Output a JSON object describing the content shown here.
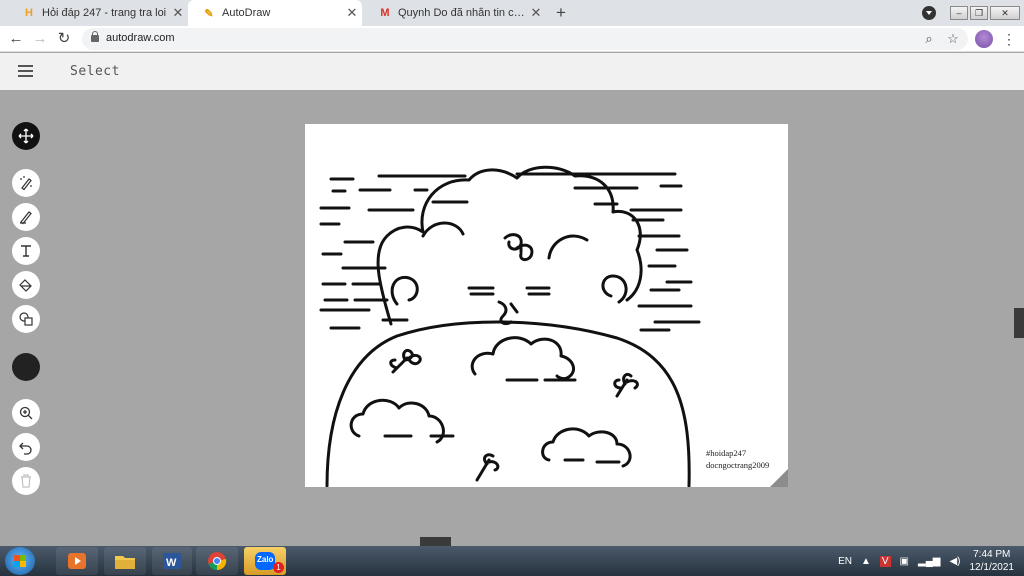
{
  "browser": {
    "tabs": [
      {
        "title": "Hỏi đáp 247 - trang tra loi",
        "favicon": "hoidap-favicon-icon",
        "active": false
      },
      {
        "title": "AutoDraw",
        "favicon": "autodraw-favicon-icon",
        "active": true
      },
      {
        "title": "Quynh Do đã nhắn tin cho bạn -",
        "favicon": "gmail-favicon-icon",
        "active": false
      }
    ],
    "url": "autodraw.com"
  },
  "app": {
    "mode_label": "Select",
    "tools": [
      {
        "name": "select-move",
        "icon": "move-arrows-icon",
        "selected": true
      },
      {
        "name": "autodraw",
        "icon": "autodraw-pen-icon"
      },
      {
        "name": "draw",
        "icon": "pencil-icon"
      },
      {
        "name": "type",
        "icon": "text-icon"
      },
      {
        "name": "fill",
        "icon": "paint-bucket-icon"
      },
      {
        "name": "shape",
        "icon": "shapes-icon"
      },
      {
        "name": "color",
        "icon": "color-swatch-icon",
        "value": "#222222"
      },
      {
        "name": "zoom",
        "icon": "zoom-in-icon"
      },
      {
        "name": "undo",
        "icon": "undo-icon"
      },
      {
        "name": "delete",
        "icon": "trash-icon",
        "disabled": true
      }
    ],
    "canvas": {
      "watermark_line1": "#hoidap247",
      "watermark_line2": "docngoctrang2009"
    }
  },
  "taskbar": {
    "apps": [
      "start-button",
      "media-player",
      "file-explorer",
      "word",
      "chrome",
      "zalo"
    ],
    "zalo_label": "Zalo",
    "zalo_badge": "1",
    "language": "EN",
    "time": "7:44 PM",
    "date": "12/1/2021"
  },
  "colors": {
    "canvas_bg": "#ffffff",
    "workspace_bg": "#a6a6a6",
    "ink": "#111111"
  }
}
